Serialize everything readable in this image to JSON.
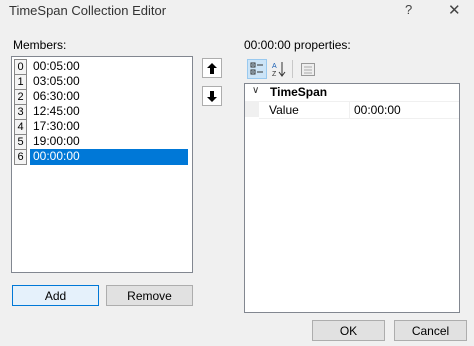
{
  "window": {
    "title": "TimeSpan Collection Editor",
    "help_glyph": "?",
    "close_glyph": "✕"
  },
  "members": {
    "label": "Members:",
    "items": [
      {
        "index": "0",
        "value": "00:05:00"
      },
      {
        "index": "1",
        "value": "03:05:00"
      },
      {
        "index": "2",
        "value": "06:30:00"
      },
      {
        "index": "3",
        "value": "12:45:00"
      },
      {
        "index": "4",
        "value": "17:30:00"
      },
      {
        "index": "5",
        "value": "19:00:00"
      },
      {
        "index": "6",
        "value": "00:00:00"
      }
    ],
    "selected_index": 6
  },
  "buttons": {
    "add": "Add",
    "remove": "Remove",
    "ok": "OK",
    "cancel": "Cancel"
  },
  "properties": {
    "label": "00:00:00 properties:",
    "category": "TimeSpan",
    "rows": [
      {
        "name": "Value",
        "value": "00:00:00"
      }
    ]
  },
  "colors": {
    "selection": "#0078d7",
    "background": "#f0f0f0"
  }
}
